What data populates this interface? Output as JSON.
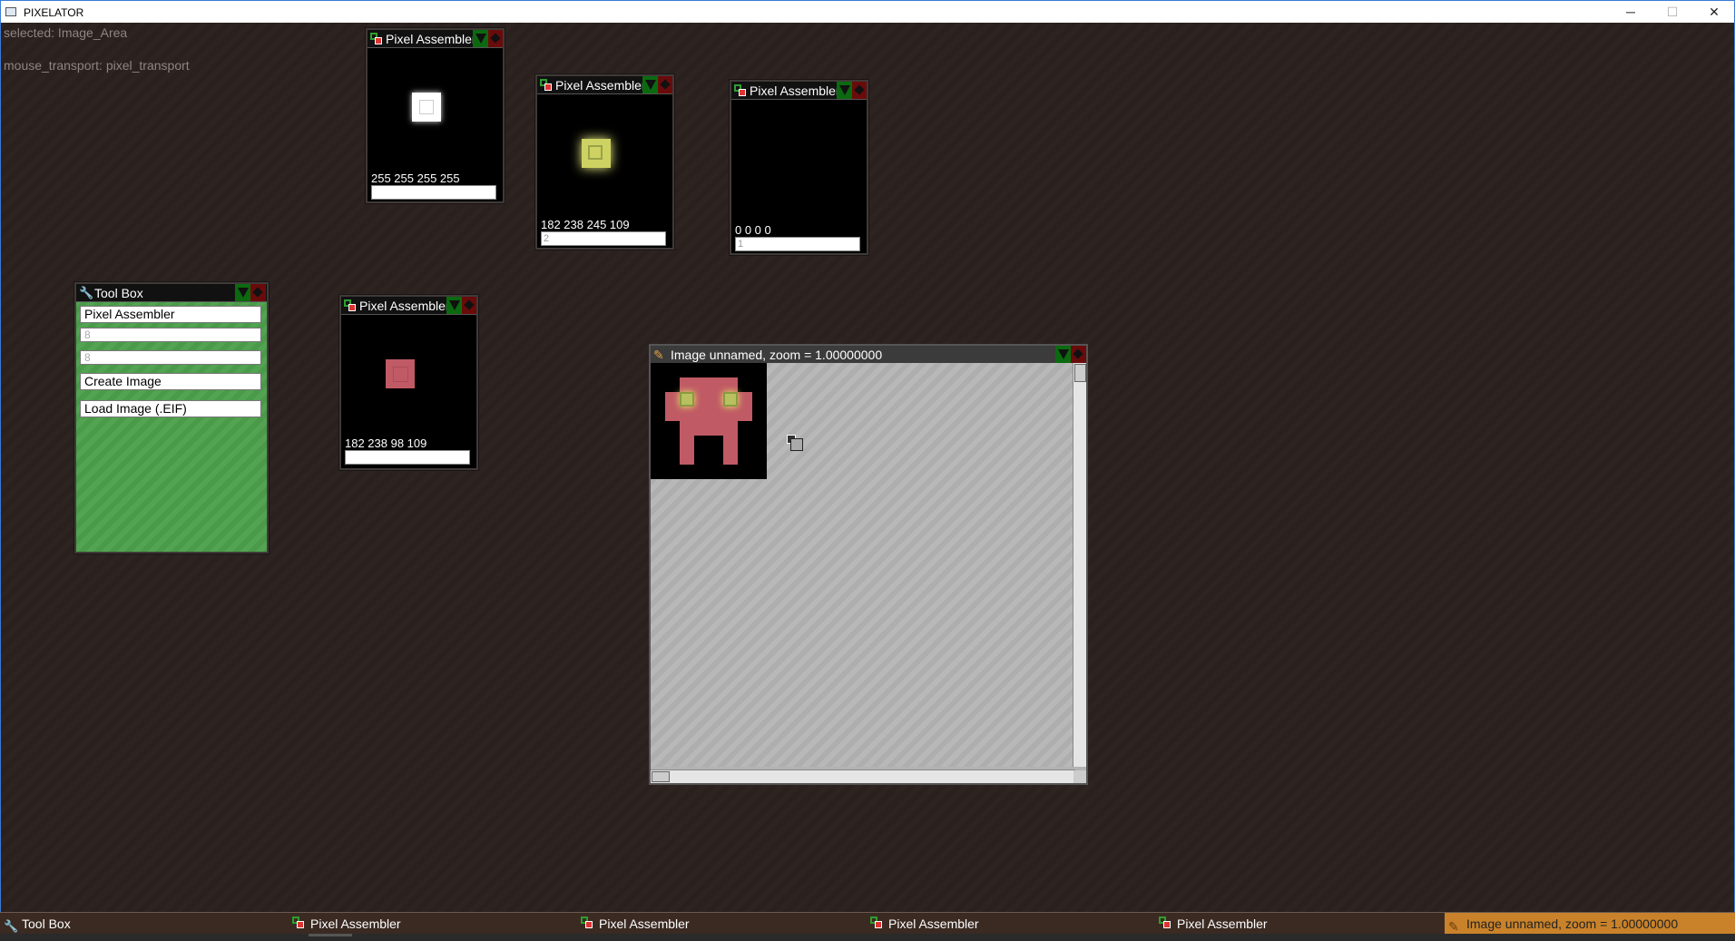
{
  "window": {
    "title": "PIXELATOR",
    "minimize": "─",
    "maximize": "☐",
    "close": "✕"
  },
  "status": {
    "selected": "selected: Image_Area",
    "mouse_transport": "mouse_transport: pixel_transport"
  },
  "pixel_assemblers": [
    {
      "title": "Pixel Assembler",
      "rgba": "255 255 255 255",
      "input_value": "",
      "swatch_color": "#ffffff"
    },
    {
      "title": "Pixel Assembler",
      "rgba": "182 238 245 109",
      "input_value": "2",
      "swatch_color": "#d8dc6c"
    },
    {
      "title": "Pixel Assembler",
      "rgba": "0 0 0 0",
      "input_value": "1",
      "swatch_color": "#000000"
    },
    {
      "title": "Pixel Assembler",
      "rgba": "182 238 98 109",
      "input_value": "",
      "swatch_color": "#c05a64"
    }
  ],
  "toolbox": {
    "title": "Tool Box",
    "items": [
      "Pixel Assembler",
      "8",
      "8",
      "Create Image",
      "Load Image (.EIF)"
    ]
  },
  "image_area": {
    "title": "Image unnamed, zoom = 1.00000000"
  },
  "taskbar": [
    {
      "label": "Tool Box",
      "icon": "wrench-icon"
    },
    {
      "label": "Pixel Assembler",
      "icon": "pixel-assembler-icon"
    },
    {
      "label": "Pixel Assembler",
      "icon": "pixel-assembler-icon"
    },
    {
      "label": "Pixel Assembler",
      "icon": "pixel-assembler-icon"
    },
    {
      "label": "Pixel Assembler",
      "icon": "pixel-assembler-icon"
    },
    {
      "label": "Image unnamed, zoom = 1.00000000",
      "icon": "pencil-icon",
      "active": true
    }
  ],
  "colors": {
    "accent": "#c9822a",
    "toolbox_bg": "#4fa14f",
    "workspace_bg": "#2c2220"
  }
}
